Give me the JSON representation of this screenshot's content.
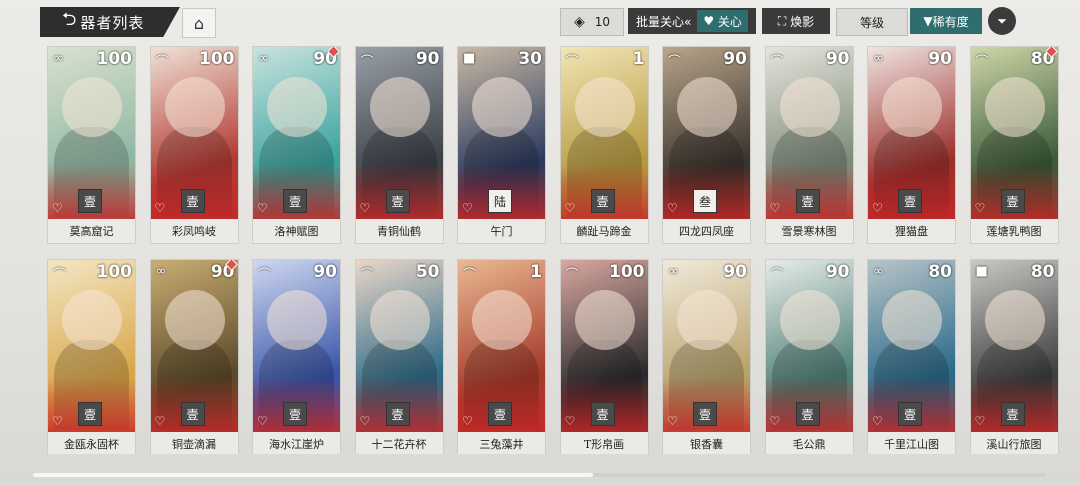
{
  "header": {
    "back_arrow": "⮌",
    "title": "器者列表",
    "home_icon": "⌂",
    "count_icon": "◈",
    "count": "10",
    "batch_label": "批量关心«",
    "batch_toggle": "关心",
    "reshape_label": "焕影",
    "level_label": "等级",
    "rarity_label": "稀有度",
    "filter_icon": "⏷"
  },
  "cards": [
    {
      "name": "莫高窟记",
      "level": "100",
      "art": [
        "#8fb7a3",
        "#d9e2cf"
      ],
      "seal": "壹",
      "seal_dark": true,
      "cls": "∞",
      "dot": false
    },
    {
      "name": "彩凤鸣岐",
      "level": "100",
      "art": [
        "#b33a33",
        "#efe1d5"
      ],
      "seal": "壹",
      "seal_dark": true,
      "cls": "⌒",
      "dot": false
    },
    {
      "name": "洛神赋图",
      "level": "90",
      "art": [
        "#3aa39d",
        "#c9e3e0"
      ],
      "seal": "壹",
      "seal_dark": true,
      "cls": "∞",
      "dot": true
    },
    {
      "name": "青铜仙鹤",
      "level": "90",
      "art": [
        "#3b3f46",
        "#9aa0a8"
      ],
      "seal": "壹",
      "seal_dark": true,
      "cls": "⌒",
      "dot": false
    },
    {
      "name": "午门",
      "level": "30",
      "art": [
        "#2a3a5e",
        "#c9b9a6"
      ],
      "seal": "陆",
      "seal_dark": false,
      "cls": "■",
      "dot": false
    },
    {
      "name": "麟趾马蹄金",
      "level": "1",
      "art": [
        "#b69a3e",
        "#f2e5b6"
      ],
      "seal": "壹",
      "seal_dark": true,
      "cls": "⌒",
      "dot": false
    },
    {
      "name": "四龙四凤座",
      "level": "90",
      "art": [
        "#3a332d",
        "#b8a58b"
      ],
      "seal": "叁",
      "seal_dark": false,
      "cls": "⌒",
      "dot": false
    },
    {
      "name": "雪景寒林图",
      "level": "90",
      "art": [
        "#7d8c7a",
        "#e6e4dc"
      ],
      "seal": "壹",
      "seal_dark": true,
      "cls": "⌒",
      "dot": false
    },
    {
      "name": "狸猫盘",
      "level": "90",
      "art": [
        "#9c2f2c",
        "#efe4e0"
      ],
      "seal": "壹",
      "seal_dark": true,
      "cls": "∞",
      "dot": false
    },
    {
      "name": "莲塘乳鸭图",
      "level": "80",
      "art": [
        "#3a5a3a",
        "#cfd7a8"
      ],
      "seal": "壹",
      "seal_dark": true,
      "cls": "⌒",
      "dot": true
    },
    {
      "name": "金瓯永固杯",
      "level": "100",
      "art": [
        "#d9a74a",
        "#f3e6c4"
      ],
      "seal": "壹",
      "seal_dark": true,
      "cls": "⌒",
      "dot": false
    },
    {
      "name": "铜壶滴漏",
      "level": "90",
      "art": [
        "#5c4a2a",
        "#c9ad73"
      ],
      "seal": "壹",
      "seal_dark": true,
      "cls": "∞",
      "dot": true
    },
    {
      "name": "海水江崖炉",
      "level": "90",
      "art": [
        "#3a55a8",
        "#cfd8f0"
      ],
      "seal": "壹",
      "seal_dark": true,
      "cls": "⌒",
      "dot": false
    },
    {
      "name": "十二花卉杯",
      "level": "50",
      "art": [
        "#2f6b88",
        "#e9d6c8"
      ],
      "seal": "壹",
      "seal_dark": true,
      "cls": "⌒",
      "dot": false
    },
    {
      "name": "三兔藻井",
      "level": "1",
      "art": [
        "#a53a2a",
        "#e9b893"
      ],
      "seal": "壹",
      "seal_dark": true,
      "cls": "⌒",
      "dot": false
    },
    {
      "name": "T形帛画",
      "level": "100",
      "art": [
        "#2b2b2e",
        "#d9a8a0"
      ],
      "seal": "壹",
      "seal_dark": true,
      "cls": "⌒",
      "dot": false
    },
    {
      "name": "银香囊",
      "level": "90",
      "art": [
        "#b8a26a",
        "#f1eadb"
      ],
      "seal": "壹",
      "seal_dark": true,
      "cls": "∞",
      "dot": false
    },
    {
      "name": "毛公鼎",
      "level": "90",
      "art": [
        "#4f7f78",
        "#e6ece8"
      ],
      "seal": "壹",
      "seal_dark": true,
      "cls": "⌒",
      "dot": false
    },
    {
      "name": "千里江山图",
      "level": "80",
      "art": [
        "#2a6a8a",
        "#b8c4c8"
      ],
      "seal": "壹",
      "seal_dark": true,
      "cls": "∞",
      "dot": false
    },
    {
      "name": "溪山行旅图",
      "level": "80",
      "art": [
        "#3e3f3f",
        "#c8c8c4"
      ],
      "seal": "壹",
      "seal_dark": true,
      "cls": "■",
      "dot": false
    }
  ]
}
